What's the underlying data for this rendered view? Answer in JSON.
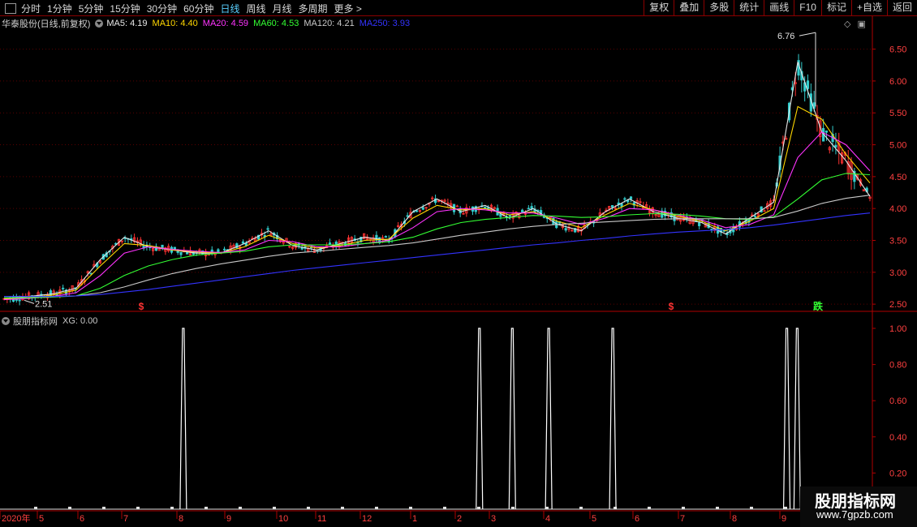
{
  "toolbar": {
    "periods": [
      "分时",
      "1分钟",
      "5分钟",
      "15分钟",
      "30分钟",
      "60分钟",
      "日线",
      "周线",
      "月线",
      "多周期",
      "更多 >"
    ],
    "active_period": "日线",
    "actions": [
      "复权",
      "叠加",
      "多股",
      "统计",
      "画线",
      "F10",
      "标记",
      "+自选",
      "返回"
    ]
  },
  "main_chart": {
    "title": "华泰股份(日线,前复权)",
    "ma": [
      {
        "label": "MA5: 4.19",
        "color": "#e8e8e8"
      },
      {
        "label": "MA10: 4.40",
        "color": "#ffd700"
      },
      {
        "label": "MA20: 4.59",
        "color": "#ff33ff"
      },
      {
        "label": "MA60: 4.53",
        "color": "#33ff33"
      },
      {
        "label": "MA120: 4.21",
        "color": "#c8c8c8"
      },
      {
        "label": "MA250: 3.93",
        "color": "#3333ff"
      }
    ],
    "high_label": "6.76",
    "low_label": "2.51",
    "price_axis": [
      "6.50",
      "6.00",
      "5.50",
      "5.00",
      "4.50",
      "4.00",
      "3.50",
      "3.00",
      "2.50"
    ],
    "markers": [
      {
        "text": "$",
        "color": "#ff3333"
      },
      {
        "text": "$",
        "color": "#ff3333"
      },
      {
        "text": "跌",
        "color": "#33ff33"
      }
    ],
    "colors": {
      "up": "#ff3333",
      "down": "#33cccc",
      "grid": "#5a0000",
      "axis": "#b00000",
      "ma250": "#3333ff"
    }
  },
  "indicator": {
    "title": "股朋指标网",
    "value_label": "XG: 0.00",
    "axis": [
      "1.00",
      "0.80",
      "0.60",
      "0.40",
      "0.20"
    ]
  },
  "date_axis": {
    "labels": [
      "2020年",
      "5",
      "6",
      "7",
      "8",
      "9",
      "10",
      "11",
      "12",
      "1",
      "2",
      "3",
      "4",
      "5",
      "6",
      "7",
      "8",
      "9"
    ]
  },
  "watermark": {
    "line1": "股朋指标网",
    "line2": "www.7gpzb.com"
  },
  "chart_data": {
    "type": "line",
    "title": "华泰股份(日线,前复权)",
    "series": [
      {
        "name": "MA5",
        "values": [
          2.58,
          2.62,
          2.66,
          2.75,
          3.2,
          3.55,
          3.4,
          3.35,
          3.3,
          3.3,
          3.45,
          3.65,
          3.42,
          3.35,
          3.45,
          3.55,
          3.5,
          3.95,
          4.15,
          3.95,
          4.05,
          3.85,
          4.0,
          3.75,
          3.65,
          3.95,
          4.15,
          3.95,
          3.85,
          3.78,
          3.6,
          3.85,
          4.1,
          6.3,
          5.2,
          4.75,
          4.19
        ]
      },
      {
        "name": "MA10",
        "values": [
          2.58,
          2.6,
          2.64,
          2.72,
          3.1,
          3.45,
          3.42,
          3.35,
          3.32,
          3.3,
          3.4,
          3.58,
          3.45,
          3.38,
          3.42,
          3.5,
          3.52,
          3.85,
          4.05,
          3.98,
          4.0,
          3.9,
          3.95,
          3.8,
          3.7,
          3.9,
          4.08,
          3.98,
          3.88,
          3.8,
          3.65,
          3.8,
          4.0,
          5.6,
          5.4,
          4.85,
          4.4
        ]
      },
      {
        "name": "MA20",
        "values": [
          2.57,
          2.59,
          2.62,
          2.68,
          2.95,
          3.3,
          3.4,
          3.36,
          3.33,
          3.31,
          3.35,
          3.5,
          3.48,
          3.4,
          3.4,
          3.45,
          3.5,
          3.7,
          3.95,
          4.0,
          3.98,
          3.93,
          3.93,
          3.85,
          3.75,
          3.85,
          4.0,
          3.98,
          3.9,
          3.82,
          3.7,
          3.75,
          3.9,
          4.8,
          5.2,
          5.0,
          4.59
        ]
      },
      {
        "name": "MA60",
        "values": [
          2.6,
          2.6,
          2.61,
          2.63,
          2.75,
          2.95,
          3.1,
          3.2,
          3.27,
          3.3,
          3.33,
          3.4,
          3.43,
          3.43,
          3.43,
          3.45,
          3.48,
          3.55,
          3.68,
          3.78,
          3.83,
          3.86,
          3.89,
          3.88,
          3.86,
          3.87,
          3.9,
          3.92,
          3.91,
          3.88,
          3.84,
          3.83,
          3.87,
          4.15,
          4.45,
          4.55,
          4.53
        ]
      },
      {
        "name": "MA120",
        "values": [
          2.62,
          2.62,
          2.62,
          2.63,
          2.68,
          2.77,
          2.88,
          2.98,
          3.06,
          3.13,
          3.19,
          3.25,
          3.3,
          3.33,
          3.36,
          3.39,
          3.42,
          3.46,
          3.52,
          3.58,
          3.63,
          3.68,
          3.72,
          3.75,
          3.77,
          3.79,
          3.81,
          3.83,
          3.84,
          3.84,
          3.84,
          3.84,
          3.86,
          3.96,
          4.08,
          4.16,
          4.21
        ]
      },
      {
        "name": "MA250",
        "values": [
          2.62,
          2.62,
          2.62,
          2.63,
          2.65,
          2.69,
          2.73,
          2.78,
          2.83,
          2.88,
          2.93,
          2.98,
          3.03,
          3.07,
          3.11,
          3.15,
          3.19,
          3.23,
          3.27,
          3.31,
          3.35,
          3.39,
          3.43,
          3.46,
          3.5,
          3.53,
          3.57,
          3.6,
          3.63,
          3.65,
          3.67,
          3.7,
          3.74,
          3.79,
          3.84,
          3.89,
          3.93
        ]
      }
    ],
    "price_range": [
      2.4,
      6.8
    ],
    "xg_signals_at": [
      0.207,
      0.549,
      0.587,
      0.629,
      0.703,
      0.904,
      0.916
    ]
  }
}
